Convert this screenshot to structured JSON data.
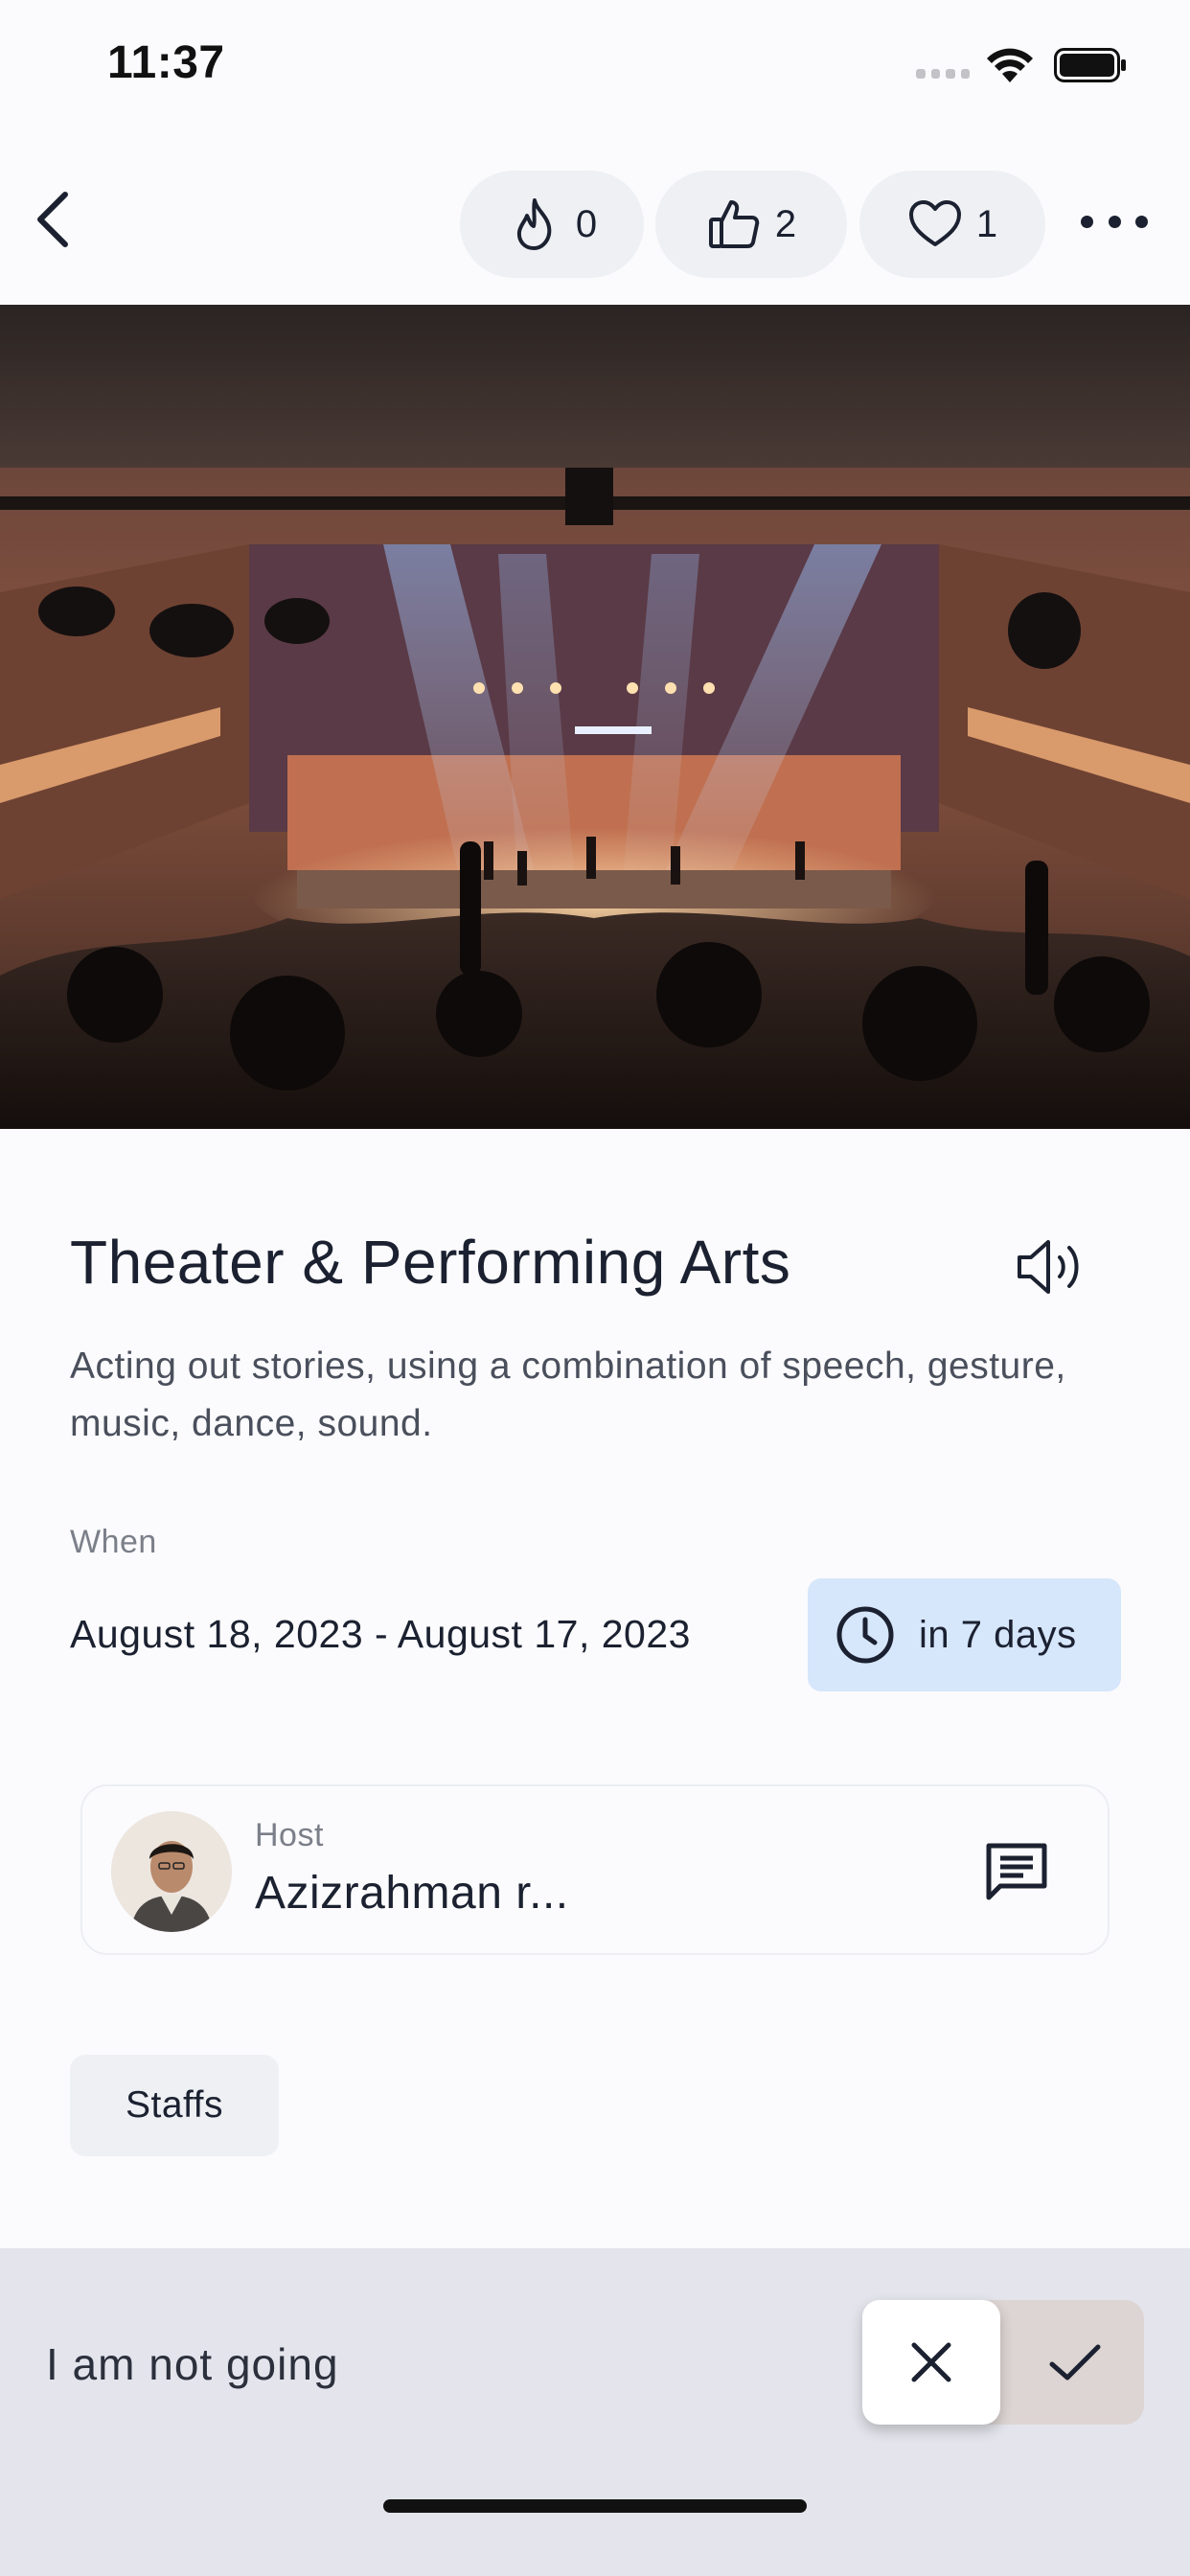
{
  "status_bar": {
    "time": "11:37"
  },
  "nav": {
    "reactions": [
      {
        "name": "fire",
        "icon": "fire-icon",
        "count": "0"
      },
      {
        "name": "like",
        "icon": "thumbs-up-icon",
        "count": "2"
      },
      {
        "name": "love",
        "icon": "heart-icon",
        "count": "1"
      }
    ]
  },
  "event": {
    "title": "Theater & Performing Arts",
    "description": "Acting out stories, using a combination of speech, gesture, music, dance, sound.",
    "when_label": "When",
    "date_range": "August 18, 2023 - August 17, 2023",
    "countdown": "in 7 days"
  },
  "host": {
    "label": "Host",
    "name": "Azizrahman r..."
  },
  "staffs_label": "Staffs",
  "rsvp": {
    "status_text": "I am not going",
    "selected": "not-going"
  },
  "colors": {
    "accent_blue_bg": "#d6e6fb",
    "pill_bg": "#eef0f4",
    "bottom_bar_bg": "#e4e4ec",
    "text_primary": "#1b2130"
  }
}
